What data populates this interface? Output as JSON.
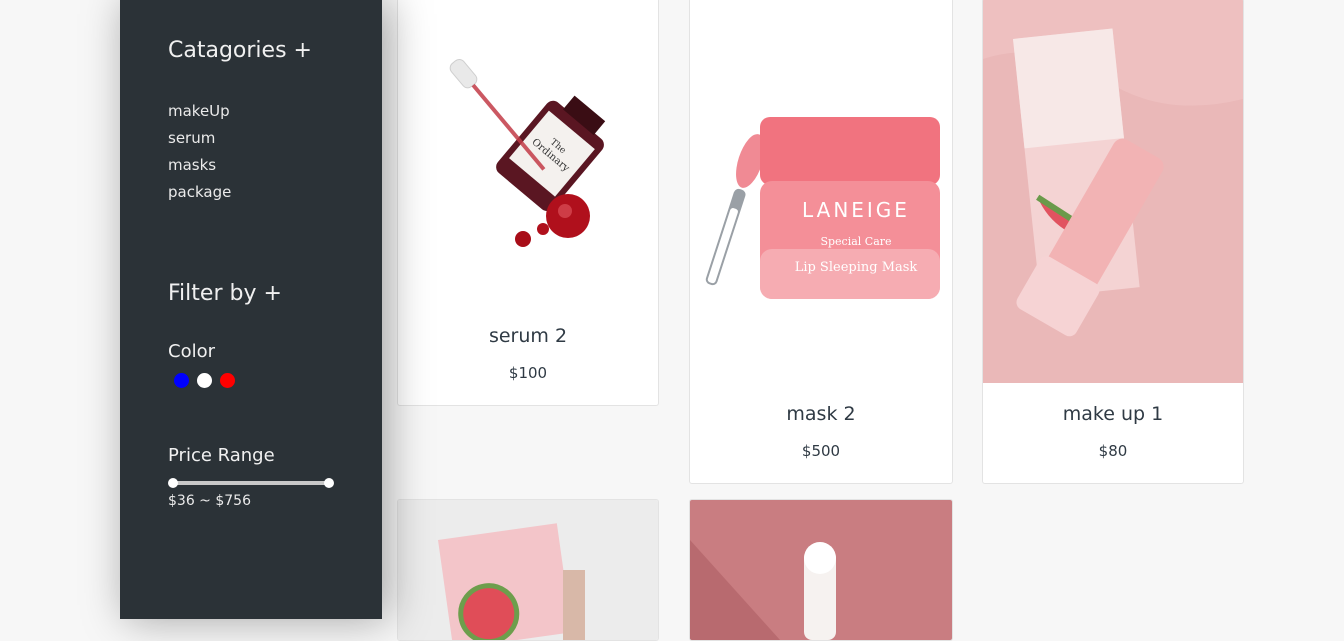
{
  "sidebar": {
    "categories_heading": "Catagories +",
    "categories": [
      "makeUp",
      "serum",
      "masks",
      "package"
    ],
    "filter_heading": "Filter by +",
    "color_label": "Color",
    "colors": [
      "#0000ff",
      "#ffffff",
      "#ff0000"
    ],
    "price_label": "Price Range",
    "price_range_text": "$36 ~ $756",
    "price_min": 36,
    "price_max": 756
  },
  "products": [
    {
      "name": "serum 2",
      "price": "$100",
      "image": "serum-bottle-image"
    },
    {
      "name": "mask 2",
      "price": "$500",
      "image": "lip-sleeping-mask-image",
      "brand_text": "LANEIGE",
      "label_line1": "Special Care",
      "label_line2": "Lip Sleeping Mask"
    },
    {
      "name": "make up 1",
      "price": "$80",
      "image": "watermelon-mist-image"
    },
    {
      "image": "watermelon-package-image"
    },
    {
      "image": "dropper-bottle-image"
    }
  ]
}
